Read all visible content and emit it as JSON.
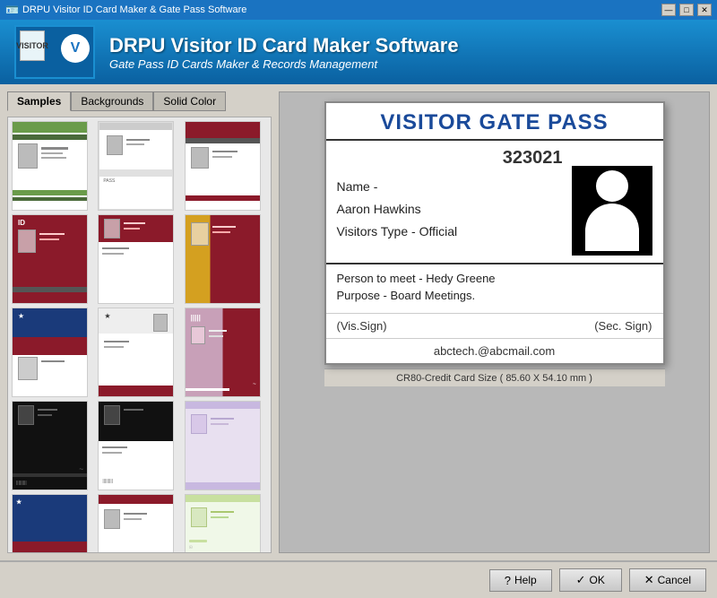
{
  "window": {
    "title": "DRPU Visitor ID Card Maker & Gate Pass Software",
    "controls": {
      "minimize": "—",
      "maximize": "□",
      "close": "✕"
    }
  },
  "header": {
    "title": "DRPU Visitor ID Card Maker Software",
    "subtitle": "Gate Pass ID Cards Maker & Records Management"
  },
  "tabs": {
    "items": [
      {
        "id": "samples",
        "label": "Samples",
        "active": true
      },
      {
        "id": "backgrounds",
        "label": "Backgrounds",
        "active": false
      },
      {
        "id": "solidcolor",
        "label": "Solid Color",
        "active": false
      }
    ]
  },
  "card": {
    "title": "VISITOR GATE PASS",
    "id_number": "323021",
    "name_label": "Name -",
    "name_value": "Aaron Hawkins",
    "visitors_type": "Visitors Type - Official",
    "person_to_meet": "Person to meet - Hedy Greene",
    "purpose": "Purpose - Board Meetings.",
    "vis_sign": "(Vis.Sign)",
    "sec_sign": "(Sec. Sign)",
    "email": "abctech.@abcmail.com"
  },
  "statusbar": {
    "text": "CR80-Credit Card Size ( 85.60 X 54.10 mm )"
  },
  "buttons": {
    "help": "Help",
    "ok": "OK",
    "cancel": "Cancel"
  },
  "colors": {
    "accent_blue": "#1a73c1",
    "card_title_blue": "#1a4a9a",
    "dark_red": "#8b1a2a"
  }
}
